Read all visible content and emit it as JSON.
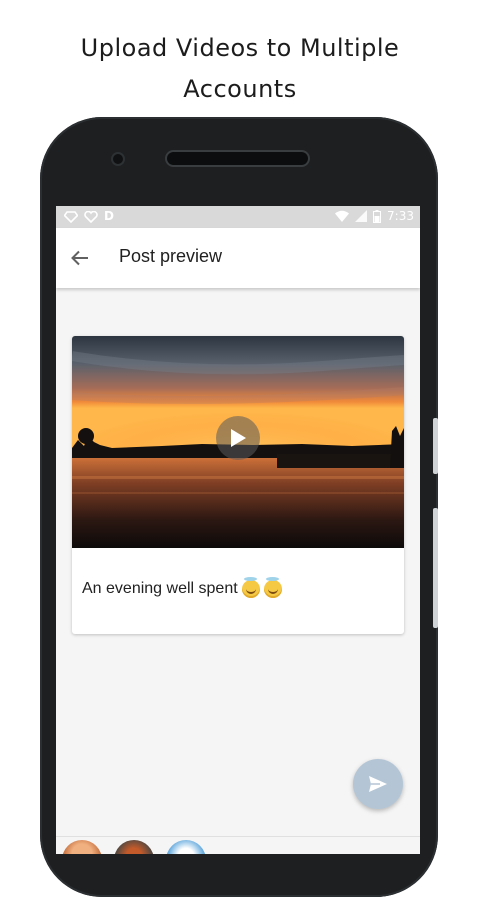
{
  "promo": {
    "line1": "Upload Videos to Multiple",
    "line2": "Accounts"
  },
  "statusbar": {
    "left_icons": [
      "diamond-icon",
      "heart-icon",
      "d-icon"
    ],
    "d_label": "D",
    "right_icons": [
      "wifi-icon",
      "signal-icon",
      "battery-icon"
    ],
    "time": "7:33"
  },
  "appbar": {
    "back_icon": "arrow-left-icon",
    "title": "Post preview"
  },
  "post": {
    "media_type": "video",
    "caption": "An evening well spent",
    "caption_emojis": [
      "smiling-face-with-halo",
      "smiling-face-with-halo"
    ]
  },
  "fab": {
    "icon": "send-icon"
  },
  "accounts": {
    "avatars": [
      "avatar-1",
      "avatar-2",
      "avatar-3"
    ]
  },
  "colors": {
    "statusbar": "#d9d9d9",
    "appbar": "#ffffff",
    "screen_bg": "#f5f5f5",
    "fab": "#b4c6d6",
    "phone_frame": "#1d1f21"
  }
}
